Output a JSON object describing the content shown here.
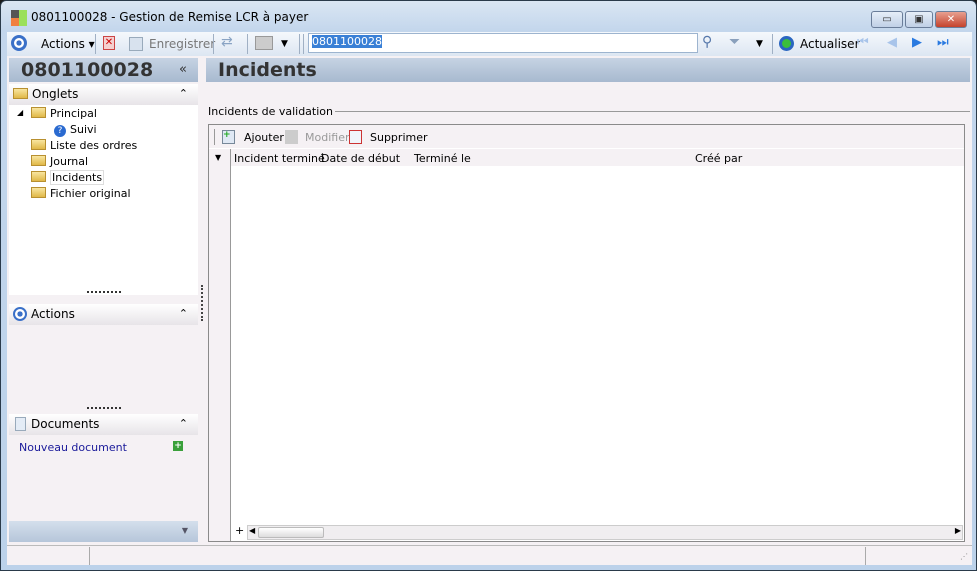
{
  "window": {
    "title": "0801100028 -  Gestion de Remise LCR à payer",
    "minimize": "▭",
    "maximize": "▣",
    "close": "✕"
  },
  "toolbar": {
    "actions": "Actions ▾",
    "save": "Enregistrer",
    "search_value": "0801100028",
    "refresh": "Actualiser"
  },
  "left": {
    "record_title": "0801100028",
    "collapse": "«",
    "onglets": {
      "title": "Onglets",
      "items": [
        "Principal",
        "Suivi",
        "Liste des ordres",
        "Journal",
        "Incidents",
        "Fichier original"
      ]
    },
    "actions": {
      "title": "Actions"
    },
    "documents": {
      "title": "Documents",
      "new_doc": "Nouveau document"
    },
    "chevron": "⌃"
  },
  "main": {
    "title": "Incidents",
    "group": "Incidents de validation",
    "grid": {
      "add": "Ajouter",
      "edit": "Modifier",
      "delete": "Supprimer",
      "columns": [
        "Incident terminé",
        "Date de début",
        "Terminé le",
        "Créé par"
      ]
    }
  }
}
